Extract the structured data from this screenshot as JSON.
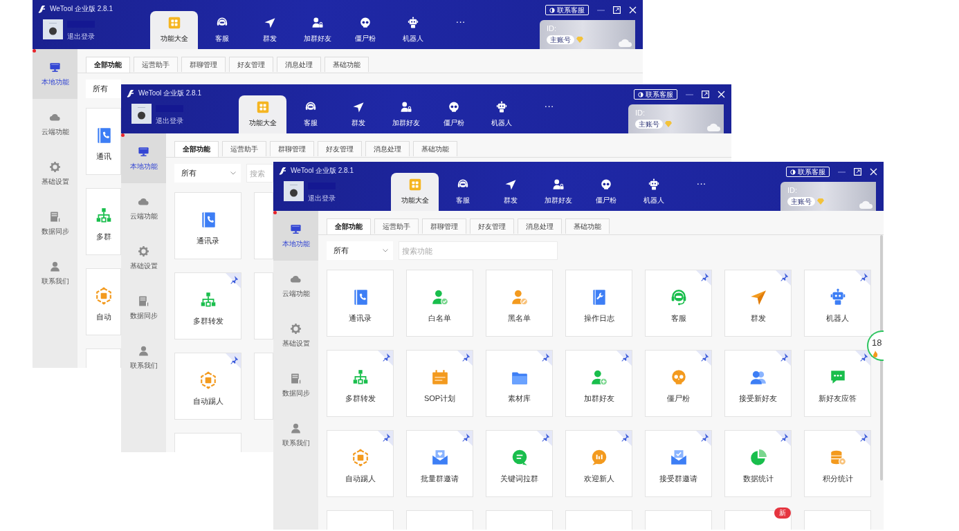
{
  "windows": [
    {
      "title": "WeTool 企业版 2.8.1",
      "user": {
        "logout": "退出登录"
      },
      "contact_button": "联系客服",
      "account": {
        "id_label": "ID:",
        "role": "主账号"
      },
      "nav": [
        {
          "label": "功能大全",
          "selected": true
        },
        {
          "label": "客服",
          "selected": false
        },
        {
          "label": "群发",
          "selected": false
        },
        {
          "label": "加群好友",
          "selected": false
        },
        {
          "label": "僵尸粉",
          "selected": false
        },
        {
          "label": "机器人",
          "selected": false
        },
        {
          "label": "···",
          "selected": false
        }
      ],
      "sidebar": [
        {
          "label": "本地功能",
          "selected": true
        },
        {
          "label": "云端功能",
          "selected": false
        },
        {
          "label": "基础设置",
          "selected": false
        },
        {
          "label": "数据同步",
          "selected": false
        },
        {
          "label": "联系我们",
          "selected": false
        }
      ],
      "tabs": [
        {
          "label": "全部功能",
          "selected": true
        },
        {
          "label": "运营助手",
          "selected": false
        },
        {
          "label": "群聊管理",
          "selected": false
        },
        {
          "label": "好友管理",
          "selected": false
        },
        {
          "label": "消息处理",
          "selected": false
        },
        {
          "label": "基础功能",
          "selected": false
        }
      ],
      "filter": {
        "value": "所有"
      },
      "card_rows": [
        [
          {
            "kind": "feature",
            "label": "通讯"
          }
        ],
        [
          {
            "kind": "feature",
            "label": "多群"
          }
        ],
        [
          {
            "kind": "feature",
            "label": "自动"
          }
        ],
        [
          {
            "kind": "blank"
          }
        ]
      ]
    },
    {
      "title": "WeTool 企业版 2.8.1",
      "user": {
        "logout": "退出登录"
      },
      "contact_button": "联系客服",
      "account": {
        "id_label": "ID:",
        "role": "主账号"
      },
      "nav": [
        {
          "label": "功能大全",
          "selected": true
        },
        {
          "label": "客服",
          "selected": false
        },
        {
          "label": "群发",
          "selected": false
        },
        {
          "label": "加群好友",
          "selected": false
        },
        {
          "label": "僵尸粉",
          "selected": false
        },
        {
          "label": "机器人",
          "selected": false
        },
        {
          "label": "···",
          "selected": false
        }
      ],
      "sidebar": [
        {
          "label": "本地功能",
          "selected": true
        },
        {
          "label": "云端功能",
          "selected": false
        },
        {
          "label": "基础设置",
          "selected": false
        },
        {
          "label": "数据同步",
          "selected": false
        },
        {
          "label": "联系我们",
          "selected": false
        }
      ],
      "tabs": [
        {
          "label": "全部功能",
          "selected": true
        },
        {
          "label": "运营助手",
          "selected": false
        },
        {
          "label": "群聊管理",
          "selected": false
        },
        {
          "label": "好友管理",
          "selected": false
        },
        {
          "label": "消息处理",
          "selected": false
        },
        {
          "label": "基础功能",
          "selected": false
        }
      ],
      "filter": {
        "value": "所有"
      },
      "search": {
        "placeholder": "搜索"
      },
      "card_rows": [
        [
          {
            "kind": "feature",
            "label": "通讯录",
            "pinned": false
          },
          {
            "kind": "blank"
          }
        ],
        [
          {
            "kind": "feature",
            "label": "多群转发",
            "pinned": true
          },
          {
            "kind": "blank"
          }
        ],
        [
          {
            "kind": "feature",
            "label": "自动踢人",
            "pinned": true
          },
          {
            "kind": "blank"
          }
        ],
        [
          {
            "kind": "blank"
          }
        ]
      ]
    },
    {
      "title": "WeTool 企业版 2.8.1",
      "user": {
        "logout": "退出登录"
      },
      "contact_button": "联系客服",
      "account": {
        "id_label": "ID:",
        "role": "主账号"
      },
      "nav": [
        {
          "label": "功能大全",
          "selected": true
        },
        {
          "label": "客服",
          "selected": false
        },
        {
          "label": "群发",
          "selected": false
        },
        {
          "label": "加群好友",
          "selected": false
        },
        {
          "label": "僵尸粉",
          "selected": false
        },
        {
          "label": "机器人",
          "selected": false
        },
        {
          "label": "···",
          "selected": false
        }
      ],
      "sidebar": [
        {
          "label": "本地功能",
          "selected": true
        },
        {
          "label": "云端功能",
          "selected": false
        },
        {
          "label": "基础设置",
          "selected": false
        },
        {
          "label": "数据同步",
          "selected": false
        },
        {
          "label": "联系我们",
          "selected": false
        }
      ],
      "tabs": [
        {
          "label": "全部功能",
          "selected": true
        },
        {
          "label": "运营助手",
          "selected": false
        },
        {
          "label": "群聊管理",
          "selected": false
        },
        {
          "label": "好友管理",
          "selected": false
        },
        {
          "label": "消息处理",
          "selected": false
        },
        {
          "label": "基础功能",
          "selected": false
        }
      ],
      "filter": {
        "value": "所有"
      },
      "search": {
        "placeholder": "搜索功能"
      },
      "card_rows": [
        [
          {
            "kind": "feature",
            "label": "通讯录",
            "pinned": false
          },
          {
            "kind": "feature",
            "label": "白名单",
            "pinned": false
          },
          {
            "kind": "feature",
            "label": "黑名单",
            "pinned": false
          },
          {
            "kind": "feature",
            "label": "操作日志",
            "pinned": false
          },
          {
            "kind": "feature",
            "label": "客服",
            "pinned": true
          },
          {
            "kind": "feature",
            "label": "群发",
            "pinned": true
          },
          {
            "kind": "feature",
            "label": "机器人",
            "pinned": true
          }
        ],
        [
          {
            "kind": "feature",
            "label": "多群转发",
            "pinned": true
          },
          {
            "kind": "feature",
            "label": "SOP计划",
            "pinned": true
          },
          {
            "kind": "feature",
            "label": "素材库",
            "pinned": true
          },
          {
            "kind": "feature",
            "label": "加群好友",
            "pinned": true
          },
          {
            "kind": "feature",
            "label": "僵尸粉",
            "pinned": true
          },
          {
            "kind": "feature",
            "label": "接受新好友",
            "pinned": true
          },
          {
            "kind": "feature",
            "label": "新好友应答",
            "pinned": true
          }
        ],
        [
          {
            "kind": "feature",
            "label": "自动踢人",
            "pinned": true
          },
          {
            "kind": "feature",
            "label": "批量群邀请",
            "pinned": true
          },
          {
            "kind": "feature",
            "label": "关键词拉群",
            "pinned": true
          },
          {
            "kind": "feature",
            "label": "欢迎新人",
            "pinned": true
          },
          {
            "kind": "feature",
            "label": "接受群邀请",
            "pinned": true
          },
          {
            "kind": "feature",
            "label": "数据统计",
            "pinned": true
          },
          {
            "kind": "feature",
            "label": "积分统计",
            "pinned": true
          }
        ],
        [
          {
            "kind": "blank"
          },
          {
            "kind": "blank"
          },
          {
            "kind": "blank"
          },
          {
            "kind": "blank"
          },
          {
            "kind": "blank"
          },
          {
            "kind": "blank",
            "badge": "新"
          },
          {
            "kind": "blank"
          }
        ]
      ],
      "float_widget": {
        "text": "18"
      }
    }
  ]
}
